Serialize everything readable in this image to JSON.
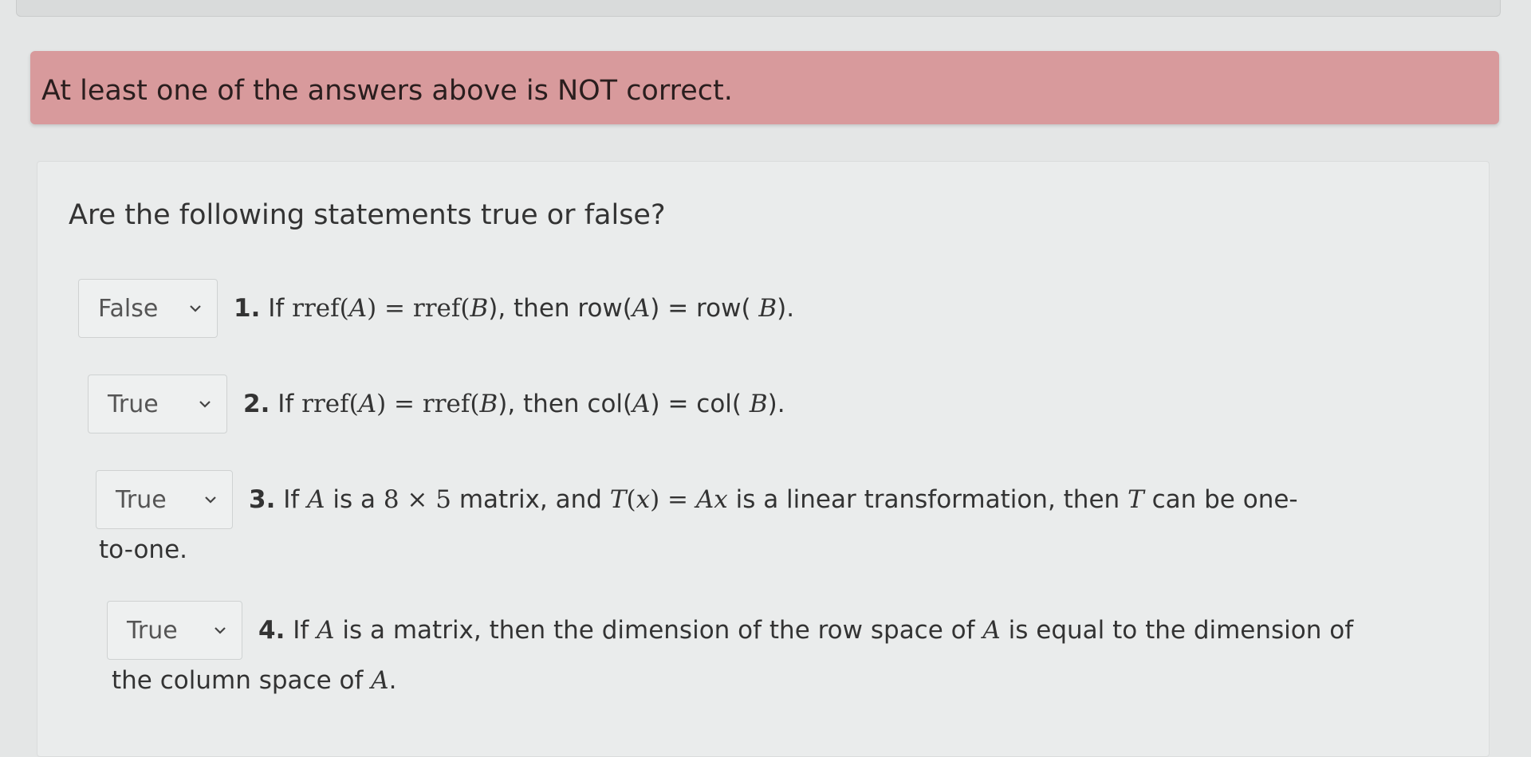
{
  "alert": {
    "text": "At least one of the answers above is NOT correct."
  },
  "question": "Are the following statements true or false?",
  "items": [
    {
      "answer": "False",
      "num": "1.",
      "parts": [
        "If ",
        "rref(",
        "A",
        ") = ",
        "rref(",
        "B",
        "), then row(",
        "A",
        ") = row( ",
        "B",
        ")."
      ]
    },
    {
      "answer": "True",
      "num": "2.",
      "parts": [
        "If ",
        "rref(",
        "A",
        ") = ",
        "rref(",
        "B",
        "), then col(",
        "A",
        ") = col( ",
        "B",
        ")."
      ]
    },
    {
      "answer": "True",
      "num": "3.",
      "parts": [
        "If ",
        "A",
        " is a ",
        "8 × 5",
        " matrix, and ",
        "T",
        "(",
        "x",
        ") = ",
        "A",
        "x",
        " is a linear transformation, then ",
        "T",
        " can be one-"
      ],
      "cont": "to-one."
    },
    {
      "answer": "True",
      "num": "4.",
      "parts": [
        "If ",
        "A",
        " is a matrix, then the dimension of the row space of ",
        "A",
        " is equal to the dimension of"
      ],
      "cont_parts": [
        "the column space of ",
        "A",
        "."
      ]
    }
  ]
}
